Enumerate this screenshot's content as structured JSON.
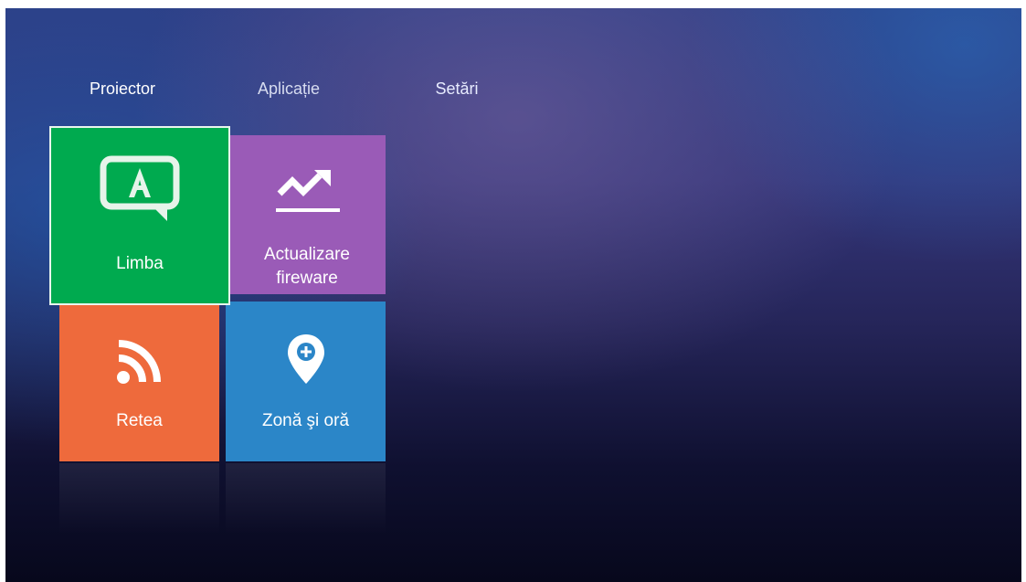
{
  "tabs": [
    {
      "label": "Proiector",
      "active": false
    },
    {
      "label": "Aplicație",
      "active": false
    },
    {
      "label": "Setări",
      "active": true
    }
  ],
  "tiles": [
    {
      "label": "Limba",
      "icon": "language-icon",
      "color": "#00aa4f",
      "selected": true
    },
    {
      "label_line1": "Actualizare",
      "label_line2": "fireware",
      "icon": "update-trend-icon",
      "color": "#9a5bb7"
    },
    {
      "label": "Retea",
      "icon": "network-rss-icon",
      "color": "#ee6a3c"
    },
    {
      "label": "Zonă şi oră",
      "icon": "location-pin-icon",
      "color": "#2b86c8"
    }
  ],
  "colors": {
    "active_tab_highlight": "#1f5fd8",
    "selected_border": "#e9f5ee"
  }
}
